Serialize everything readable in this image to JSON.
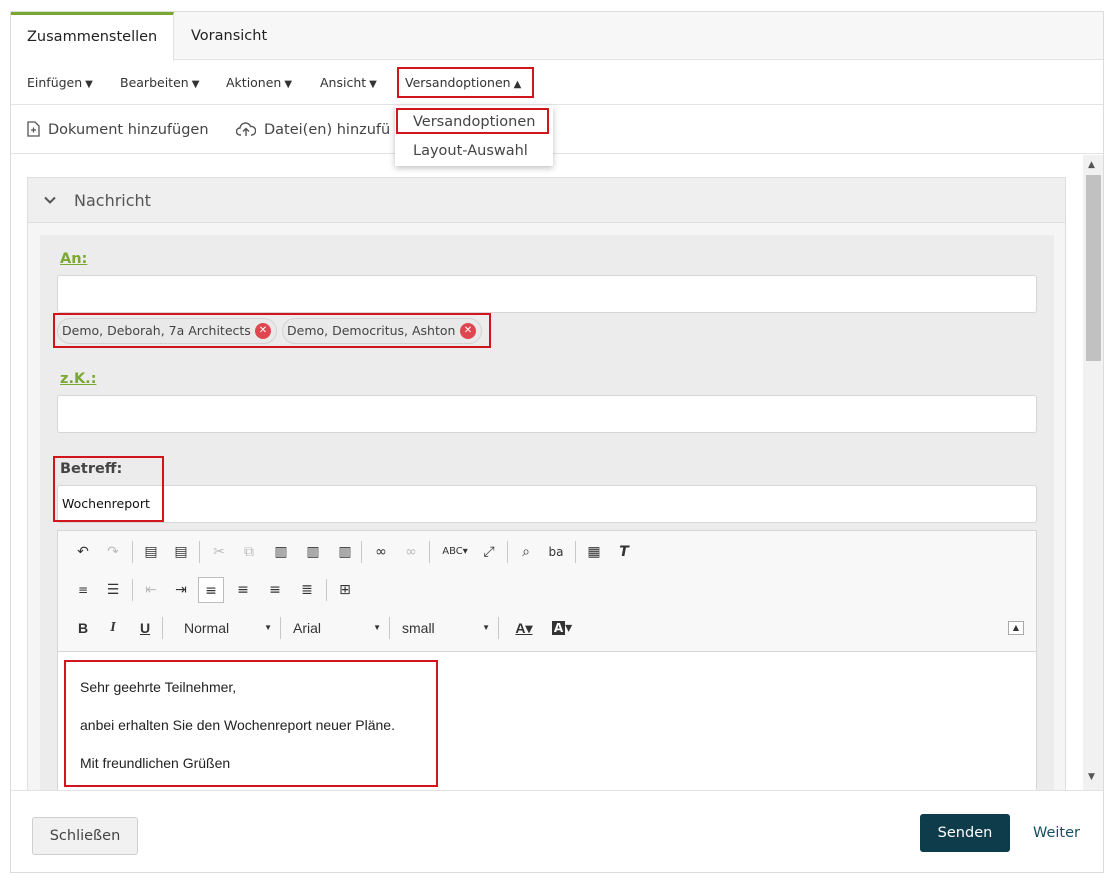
{
  "tabs": [
    {
      "label": "Zusammenstellen",
      "active": true
    },
    {
      "label": "Voransicht",
      "active": false
    }
  ],
  "menubar": {
    "items": [
      {
        "label": "Einfügen",
        "caret": "▼"
      },
      {
        "label": "Bearbeiten",
        "caret": "▼"
      },
      {
        "label": "Aktionen",
        "caret": "▼"
      },
      {
        "label": "Ansicht",
        "caret": "▼"
      },
      {
        "label": "Versandoptionen",
        "caret": "▲"
      }
    ]
  },
  "actionbar": {
    "add_document": "Dokument hinzufügen",
    "upload_files": "Datei(en) hinzufü"
  },
  "dropdown": {
    "items": [
      "Versandoptionen",
      "Layout-Auswahl"
    ]
  },
  "panel": {
    "title": "Nachricht"
  },
  "form": {
    "to_label": "An:",
    "to_value": "",
    "recipients": [
      "Demo, Deborah, 7a Architects",
      "Demo, Democritus, Ashton"
    ],
    "cc_label": "z.K.:",
    "cc_value": "",
    "subject_label": "Betreff:",
    "subject_value": "Wochenreport"
  },
  "editor": {
    "format": "Normal",
    "font": "Arial",
    "size": "small",
    "body": [
      "Sehr geehrte Teilnehmer,",
      "anbei erhalten Sie den Wochenreport neuer Pläne.",
      "Mit freundlichen Grüßen"
    ]
  },
  "footer": {
    "close": "Schließen",
    "send": "Senden",
    "next": "Weiter"
  },
  "colors": {
    "accent": "#7aa832",
    "highlight": "#d0161b",
    "primary_button": "#0e3c4b",
    "chip_remove": "#e0464f"
  }
}
